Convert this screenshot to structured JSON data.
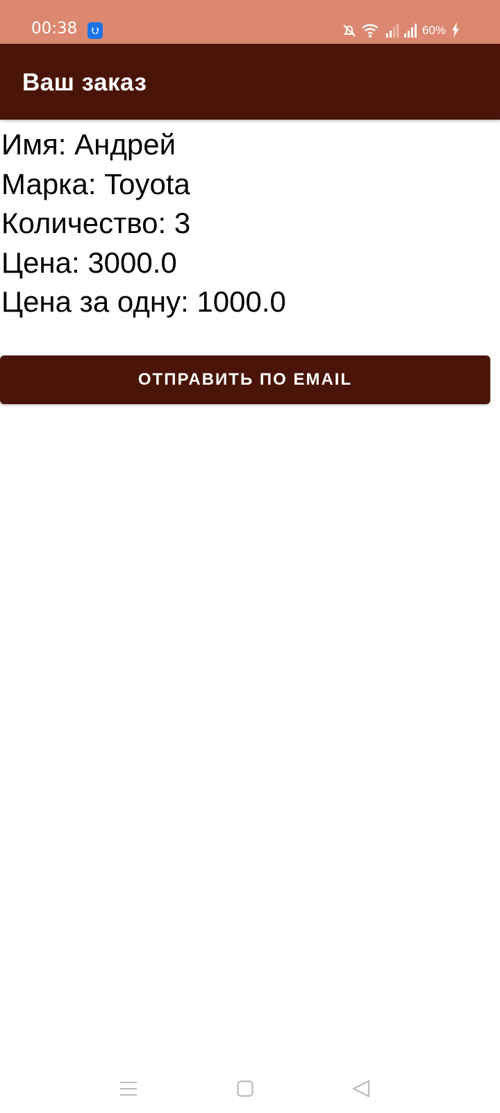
{
  "status_bar": {
    "time": "00:38",
    "battery": "60%",
    "icons": [
      "usb-icon",
      "bell-off-icon",
      "wifi-icon",
      "signal-icon",
      "signal-icon",
      "charging-icon"
    ]
  },
  "app_bar": {
    "title": "Ваш заказ"
  },
  "order": {
    "name_line": "Имя: Андрей",
    "brand_line": "Марка: Toyota",
    "quantity_line": "Количество: 3",
    "price_line": "Цена: 3000.0",
    "unit_price_line": "Цена за одну: 1000.0"
  },
  "actions": {
    "send_email_label": "ОТПРАВИТЬ ПО EMAIL"
  },
  "colors": {
    "status_bar": "#DC8870",
    "primary": "#4A1508"
  }
}
